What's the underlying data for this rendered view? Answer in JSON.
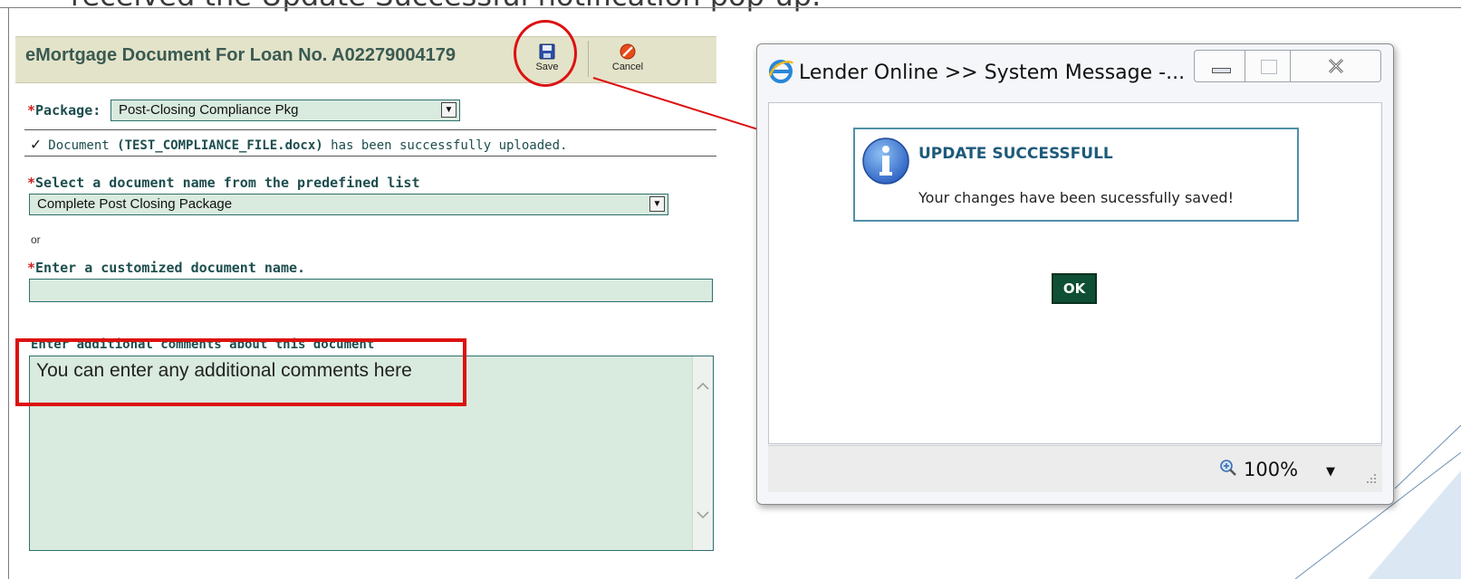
{
  "slide": {
    "caption": "received the Update Successful notification pop-up."
  },
  "form": {
    "title": "eMortgage Document For Loan No. A02279004179",
    "toolbar": {
      "save_label": "Save",
      "cancel_label": "Cancel"
    },
    "package": {
      "required_mark": "*",
      "label": "Package:",
      "value": "Post-Closing Compliance Pkg"
    },
    "upload_message": {
      "prefix": "Document ",
      "filename": "(TEST_COMPLIANCE_FILE.docx)",
      "suffix": " has been successfully uploaded."
    },
    "predefined": {
      "required_mark": "*",
      "label": "Select a document name from the predefined list",
      "value": "Complete Post Closing Package"
    },
    "or_text": "or",
    "custom_name": {
      "required_mark": "*",
      "label": "Enter a customized document name.",
      "value": ""
    },
    "comments": {
      "label": "Enter additional comments about this document",
      "value": "You can enter any additional comments here"
    }
  },
  "popup": {
    "title": "Lender Online >> System Message -...",
    "message_title": "UPDATE SUCCESSFULL",
    "message_text": "Your changes have been sucessfully saved!",
    "ok_label": "OK",
    "zoom": "100%",
    "colors": {
      "ok_button": "#0f4f35",
      "message_border": "#4f8fa8",
      "info_icon": "#2f6fcf"
    }
  },
  "annotations": {
    "color": "#dd1111"
  }
}
